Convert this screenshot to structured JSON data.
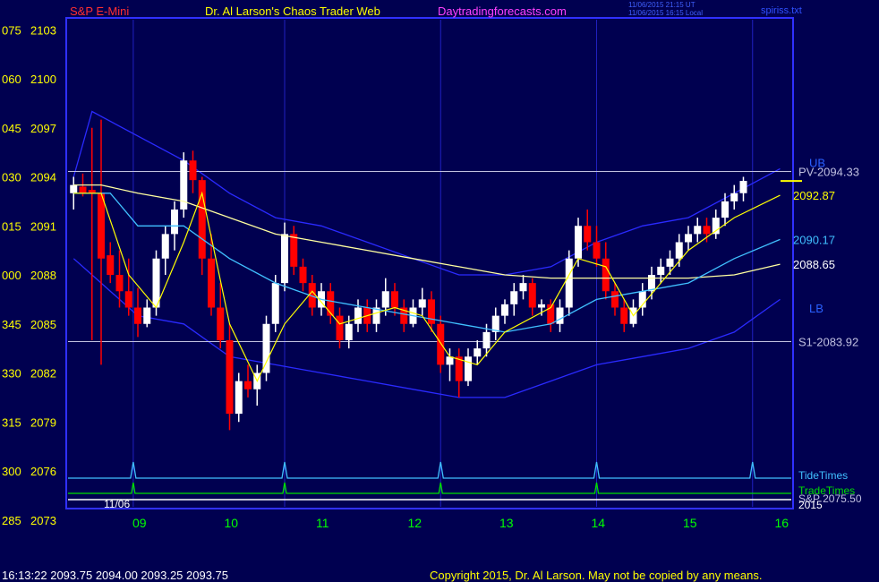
{
  "header": {
    "symbol": "S&P E-Mini",
    "title": "Dr. Al Larson's Chaos Trader Web",
    "site": "Daytradingforecasts.com",
    "stamp_line1": "11/06/2015 21:15 UT",
    "stamp_line2": "11/06/2015 16:15 Local",
    "file": "spiriss.txt"
  },
  "footer": {
    "quote": "16:13:22  2093.75  2094.00  2093.25  2093.75",
    "copyright": "Copyright 2015, Dr. Al Larson. May not be copied by any means."
  },
  "colors": {
    "background": "#000050",
    "frame": "#3030ff",
    "up_bar": "#ffffff",
    "down_bar": "#ff0000",
    "band": "#2a2aff",
    "mid_ma": "#ffffa0",
    "fast_ma": "#ffff00",
    "cyan_ma": "#40c0ff",
    "time_label": "#00ff00"
  },
  "chart_data": {
    "type": "candlestick",
    "ylim": [
      2073,
      2104
    ],
    "y_ticks": [
      {
        "value": 2103,
        "left": "075",
        "right": "2103"
      },
      {
        "value": 2100,
        "left": "060",
        "right": "2100"
      },
      {
        "value": 2097,
        "left": "045",
        "right": "2097"
      },
      {
        "value": 2094,
        "left": "030",
        "right": "2094"
      },
      {
        "value": 2091,
        "left": "015",
        "right": "2091"
      },
      {
        "value": 2088,
        "left": "000",
        "right": "2088"
      },
      {
        "value": 2085,
        "left": "345",
        "right": "2085"
      },
      {
        "value": 2082,
        "left": "330",
        "right": "2082"
      },
      {
        "value": 2079,
        "left": "315",
        "right": "2079"
      },
      {
        "value": 2076,
        "left": "300",
        "right": "2076"
      },
      {
        "value": 2073,
        "left": "285",
        "right": "2073"
      }
    ],
    "x_ticks": [
      {
        "hour": 9,
        "label": "09"
      },
      {
        "hour": 10,
        "label": "10"
      },
      {
        "hour": 11,
        "label": "11"
      },
      {
        "hour": 12,
        "label": "12"
      },
      {
        "hour": 13,
        "label": "13"
      },
      {
        "hour": 14,
        "label": "14"
      },
      {
        "hour": 15,
        "label": "15"
      },
      {
        "hour": 16,
        "label": "16"
      }
    ],
    "date_label": "11/06",
    "year_label": "2015",
    "time_lines": [
      8.95,
      10.6,
      12.3,
      14.0,
      15.7
    ],
    "levels": [
      {
        "label": "PV-2094.33",
        "value": 2094.33
      },
      {
        "label": "S1-2083.92",
        "value": 2083.92
      }
    ],
    "band_labels": [
      {
        "label": "UB",
        "value": 2094.6
      },
      {
        "label": "LB",
        "value": 2085.7
      }
    ],
    "ma_labels": [
      {
        "label": "2092.87",
        "value": 2092.87,
        "color": "#ffff00"
      },
      {
        "label": "2090.17",
        "value": 2090.17,
        "color": "#40c0ff"
      },
      {
        "label": "2088.65",
        "value": 2088.65,
        "color": "#ffffff"
      }
    ],
    "legend": [
      "TideTimes",
      "TradeTimes",
      "S&P 2075.50"
    ],
    "candles": [
      [
        8.3,
        2093.0,
        2094.0,
        2092.0,
        2093.5
      ],
      [
        8.4,
        2093.4,
        2094.2,
        2092.8,
        2093.0
      ],
      [
        8.5,
        2093.2,
        2097.0,
        2084.0,
        2093.0
      ],
      [
        8.6,
        2093.0,
        2097.5,
        2082.5,
        2089.0
      ],
      [
        8.7,
        2089.2,
        2090.0,
        2087.5,
        2088.0
      ],
      [
        8.8,
        2088.0,
        2089.5,
        2086.0,
        2087.0
      ],
      [
        8.9,
        2087.0,
        2089.0,
        2085.5,
        2086.0
      ],
      [
        9.0,
        2086.0,
        2087.2,
        2084.2,
        2085.0
      ],
      [
        9.1,
        2085.0,
        2086.5,
        2084.8,
        2086.0
      ],
      [
        9.2,
        2086.0,
        2089.5,
        2085.5,
        2089.0
      ],
      [
        9.3,
        2089.0,
        2091.0,
        2088.0,
        2090.5
      ],
      [
        9.4,
        2090.5,
        2092.5,
        2089.5,
        2092.0
      ],
      [
        9.5,
        2092.0,
        2095.5,
        2091.5,
        2095.0
      ],
      [
        9.6,
        2095.0,
        2095.6,
        2093.0,
        2093.8
      ],
      [
        9.7,
        2093.8,
        2094.0,
        2088.0,
        2089.0
      ],
      [
        9.8,
        2089.0,
        2090.5,
        2085.5,
        2086.0
      ],
      [
        9.9,
        2086.0,
        2087.5,
        2083.5,
        2084.0
      ],
      [
        10.0,
        2084.0,
        2085.0,
        2078.5,
        2079.5
      ],
      [
        10.1,
        2079.5,
        2082.0,
        2079.0,
        2081.5
      ],
      [
        10.2,
        2081.5,
        2082.5,
        2080.5,
        2081.0
      ],
      [
        10.3,
        2081.0,
        2082.5,
        2080.0,
        2082.0
      ],
      [
        10.4,
        2082.0,
        2085.5,
        2081.5,
        2085.0
      ],
      [
        10.5,
        2085.0,
        2088.0,
        2084.5,
        2087.5
      ],
      [
        10.6,
        2087.5,
        2091.2,
        2087.0,
        2090.5
      ],
      [
        10.7,
        2090.5,
        2091.0,
        2088.0,
        2088.5
      ],
      [
        10.8,
        2088.5,
        2089.0,
        2087.0,
        2087.5
      ],
      [
        10.9,
        2087.5,
        2088.0,
        2085.5,
        2086.0
      ],
      [
        11.0,
        2086.0,
        2087.5,
        2085.5,
        2087.0
      ],
      [
        11.1,
        2087.0,
        2087.5,
        2085.0,
        2085.5
      ],
      [
        11.2,
        2085.5,
        2086.0,
        2083.5,
        2084.0
      ],
      [
        11.3,
        2084.0,
        2085.5,
        2083.5,
        2085.0
      ],
      [
        11.4,
        2085.0,
        2086.5,
        2084.5,
        2086.0
      ],
      [
        11.5,
        2086.0,
        2086.5,
        2084.5,
        2085.0
      ],
      [
        11.6,
        2085.0,
        2086.5,
        2084.5,
        2086.0
      ],
      [
        11.7,
        2086.0,
        2087.8,
        2085.5,
        2087.0
      ],
      [
        11.8,
        2087.0,
        2087.5,
        2085.5,
        2086.0
      ],
      [
        11.9,
        2086.0,
        2086.5,
        2084.5,
        2085.0
      ],
      [
        12.0,
        2085.0,
        2086.5,
        2084.8,
        2086.0
      ],
      [
        12.1,
        2086.0,
        2087.2,
        2085.5,
        2086.5
      ],
      [
        12.2,
        2086.5,
        2087.0,
        2084.5,
        2085.0
      ],
      [
        12.3,
        2085.0,
        2085.5,
        2082.0,
        2082.5
      ],
      [
        12.4,
        2082.5,
        2083.5,
        2081.5,
        2083.0
      ],
      [
        12.5,
        2083.0,
        2083.5,
        2080.5,
        2081.5
      ],
      [
        12.6,
        2081.5,
        2083.5,
        2081.2,
        2083.0
      ],
      [
        12.7,
        2083.0,
        2084.0,
        2082.5,
        2083.5
      ],
      [
        12.8,
        2083.5,
        2085.0,
        2083.0,
        2084.5
      ],
      [
        12.9,
        2084.5,
        2086.0,
        2084.0,
        2085.5
      ],
      [
        13.0,
        2085.5,
        2086.5,
        2085.0,
        2086.2
      ],
      [
        13.1,
        2086.2,
        2087.5,
        2085.5,
        2087.0
      ],
      [
        13.2,
        2087.0,
        2088.0,
        2086.5,
        2087.5
      ],
      [
        13.3,
        2087.5,
        2087.8,
        2085.5,
        2086.0
      ],
      [
        13.4,
        2086.0,
        2086.5,
        2085.5,
        2086.2
      ],
      [
        13.5,
        2086.2,
        2086.5,
        2084.5,
        2085.0
      ],
      [
        13.6,
        2085.0,
        2086.5,
        2084.5,
        2086.0
      ],
      [
        13.7,
        2086.0,
        2089.5,
        2085.5,
        2089.0
      ],
      [
        13.8,
        2089.0,
        2091.5,
        2088.5,
        2091.0
      ],
      [
        13.9,
        2091.0,
        2092.0,
        2089.5,
        2090.0
      ],
      [
        14.0,
        2090.0,
        2091.0,
        2088.5,
        2089.0
      ],
      [
        14.1,
        2089.0,
        2090.0,
        2086.5,
        2087.0
      ],
      [
        14.2,
        2087.0,
        2087.5,
        2085.5,
        2086.0
      ],
      [
        14.3,
        2086.0,
        2086.5,
        2084.5,
        2085.0
      ],
      [
        14.4,
        2085.0,
        2086.5,
        2084.8,
        2086.0
      ],
      [
        14.5,
        2086.0,
        2087.5,
        2085.5,
        2087.0
      ],
      [
        14.6,
        2087.0,
        2088.5,
        2086.5,
        2088.0
      ],
      [
        14.7,
        2088.0,
        2089.0,
        2087.5,
        2088.5
      ],
      [
        14.8,
        2088.5,
        2089.5,
        2088.0,
        2089.0
      ],
      [
        14.9,
        2089.0,
        2090.5,
        2088.5,
        2090.0
      ],
      [
        15.0,
        2090.0,
        2091.0,
        2089.5,
        2090.5
      ],
      [
        15.1,
        2090.5,
        2091.5,
        2090.0,
        2091.0
      ],
      [
        15.2,
        2091.0,
        2091.5,
        2090.0,
        2090.5
      ],
      [
        15.3,
        2090.5,
        2092.0,
        2090.2,
        2091.5
      ],
      [
        15.4,
        2091.5,
        2093.0,
        2091.0,
        2092.5
      ],
      [
        15.5,
        2092.5,
        2093.5,
        2092.0,
        2093.0
      ],
      [
        15.6,
        2093.0,
        2094.0,
        2092.5,
        2093.75
      ]
    ],
    "series": [
      {
        "key": "upper_band",
        "color": "#2a2aff",
        "values": [
          [
            8.3,
            2094
          ],
          [
            8.5,
            2098
          ],
          [
            9.0,
            2096.5
          ],
          [
            9.5,
            2095
          ],
          [
            10.0,
            2093
          ],
          [
            10.5,
            2091.5
          ],
          [
            11.0,
            2091
          ],
          [
            11.5,
            2090
          ],
          [
            12.0,
            2089
          ],
          [
            12.5,
            2088
          ],
          [
            13.0,
            2088
          ],
          [
            13.5,
            2088.5
          ],
          [
            14.0,
            2090
          ],
          [
            14.5,
            2091
          ],
          [
            15.0,
            2091.5
          ],
          [
            15.5,
            2093
          ],
          [
            16.0,
            2094.5
          ]
        ]
      },
      {
        "key": "lower_band",
        "color": "#2a2aff",
        "values": [
          [
            8.3,
            2089
          ],
          [
            8.5,
            2088
          ],
          [
            9.0,
            2085.5
          ],
          [
            9.5,
            2085
          ],
          [
            10.0,
            2083
          ],
          [
            10.5,
            2082.5
          ],
          [
            11.0,
            2082
          ],
          [
            11.5,
            2081.5
          ],
          [
            12.0,
            2081
          ],
          [
            12.5,
            2080.5
          ],
          [
            13.0,
            2080.5
          ],
          [
            13.5,
            2081.5
          ],
          [
            14.0,
            2082.5
          ],
          [
            14.5,
            2083
          ],
          [
            15.0,
            2083.5
          ],
          [
            15.5,
            2084.5
          ],
          [
            16.0,
            2086.5
          ]
        ]
      },
      {
        "key": "mid_ma",
        "color": "#ffffa0",
        "values": [
          [
            8.3,
            2093.5
          ],
          [
            8.6,
            2093.5
          ],
          [
            9.0,
            2093
          ],
          [
            9.5,
            2092.5
          ],
          [
            10.0,
            2091.5
          ],
          [
            10.5,
            2090.5
          ],
          [
            11.0,
            2090
          ],
          [
            11.5,
            2089.5
          ],
          [
            12.0,
            2089
          ],
          [
            12.5,
            2088.5
          ],
          [
            13.0,
            2088
          ],
          [
            13.5,
            2087.8
          ],
          [
            14.0,
            2087.8
          ],
          [
            14.5,
            2087.8
          ],
          [
            15.0,
            2087.8
          ],
          [
            15.5,
            2088
          ],
          [
            16.0,
            2088.65
          ]
        ]
      },
      {
        "key": "cyan_ma",
        "color": "#40c0ff",
        "values": [
          [
            8.3,
            2093
          ],
          [
            8.7,
            2093
          ],
          [
            9.0,
            2091
          ],
          [
            9.5,
            2091
          ],
          [
            10.0,
            2089
          ],
          [
            10.5,
            2087.5
          ],
          [
            11.0,
            2086.5
          ],
          [
            11.5,
            2086
          ],
          [
            12.0,
            2085.5
          ],
          [
            12.5,
            2085
          ],
          [
            13.0,
            2084.5
          ],
          [
            13.5,
            2085
          ],
          [
            14.0,
            2086.5
          ],
          [
            14.5,
            2087
          ],
          [
            15.0,
            2087.5
          ],
          [
            15.5,
            2089
          ],
          [
            16.0,
            2090.17
          ]
        ]
      },
      {
        "key": "fast_ma",
        "color": "#ffff00",
        "values": [
          [
            8.3,
            2093
          ],
          [
            8.6,
            2093
          ],
          [
            8.9,
            2088
          ],
          [
            9.2,
            2086
          ],
          [
            9.5,
            2090
          ],
          [
            9.7,
            2093
          ],
          [
            10.0,
            2085
          ],
          [
            10.3,
            2081.5
          ],
          [
            10.6,
            2085
          ],
          [
            10.9,
            2087
          ],
          [
            11.2,
            2085
          ],
          [
            11.5,
            2085.5
          ],
          [
            11.8,
            2086
          ],
          [
            12.1,
            2085.5
          ],
          [
            12.4,
            2083
          ],
          [
            12.7,
            2082.5
          ],
          [
            13.0,
            2084.5
          ],
          [
            13.5,
            2086
          ],
          [
            13.8,
            2089
          ],
          [
            14.1,
            2088.5
          ],
          [
            14.4,
            2085.5
          ],
          [
            14.7,
            2087.5
          ],
          [
            15.0,
            2089.5
          ],
          [
            15.5,
            2091.5
          ],
          [
            16.0,
            2092.87
          ]
        ]
      }
    ]
  }
}
